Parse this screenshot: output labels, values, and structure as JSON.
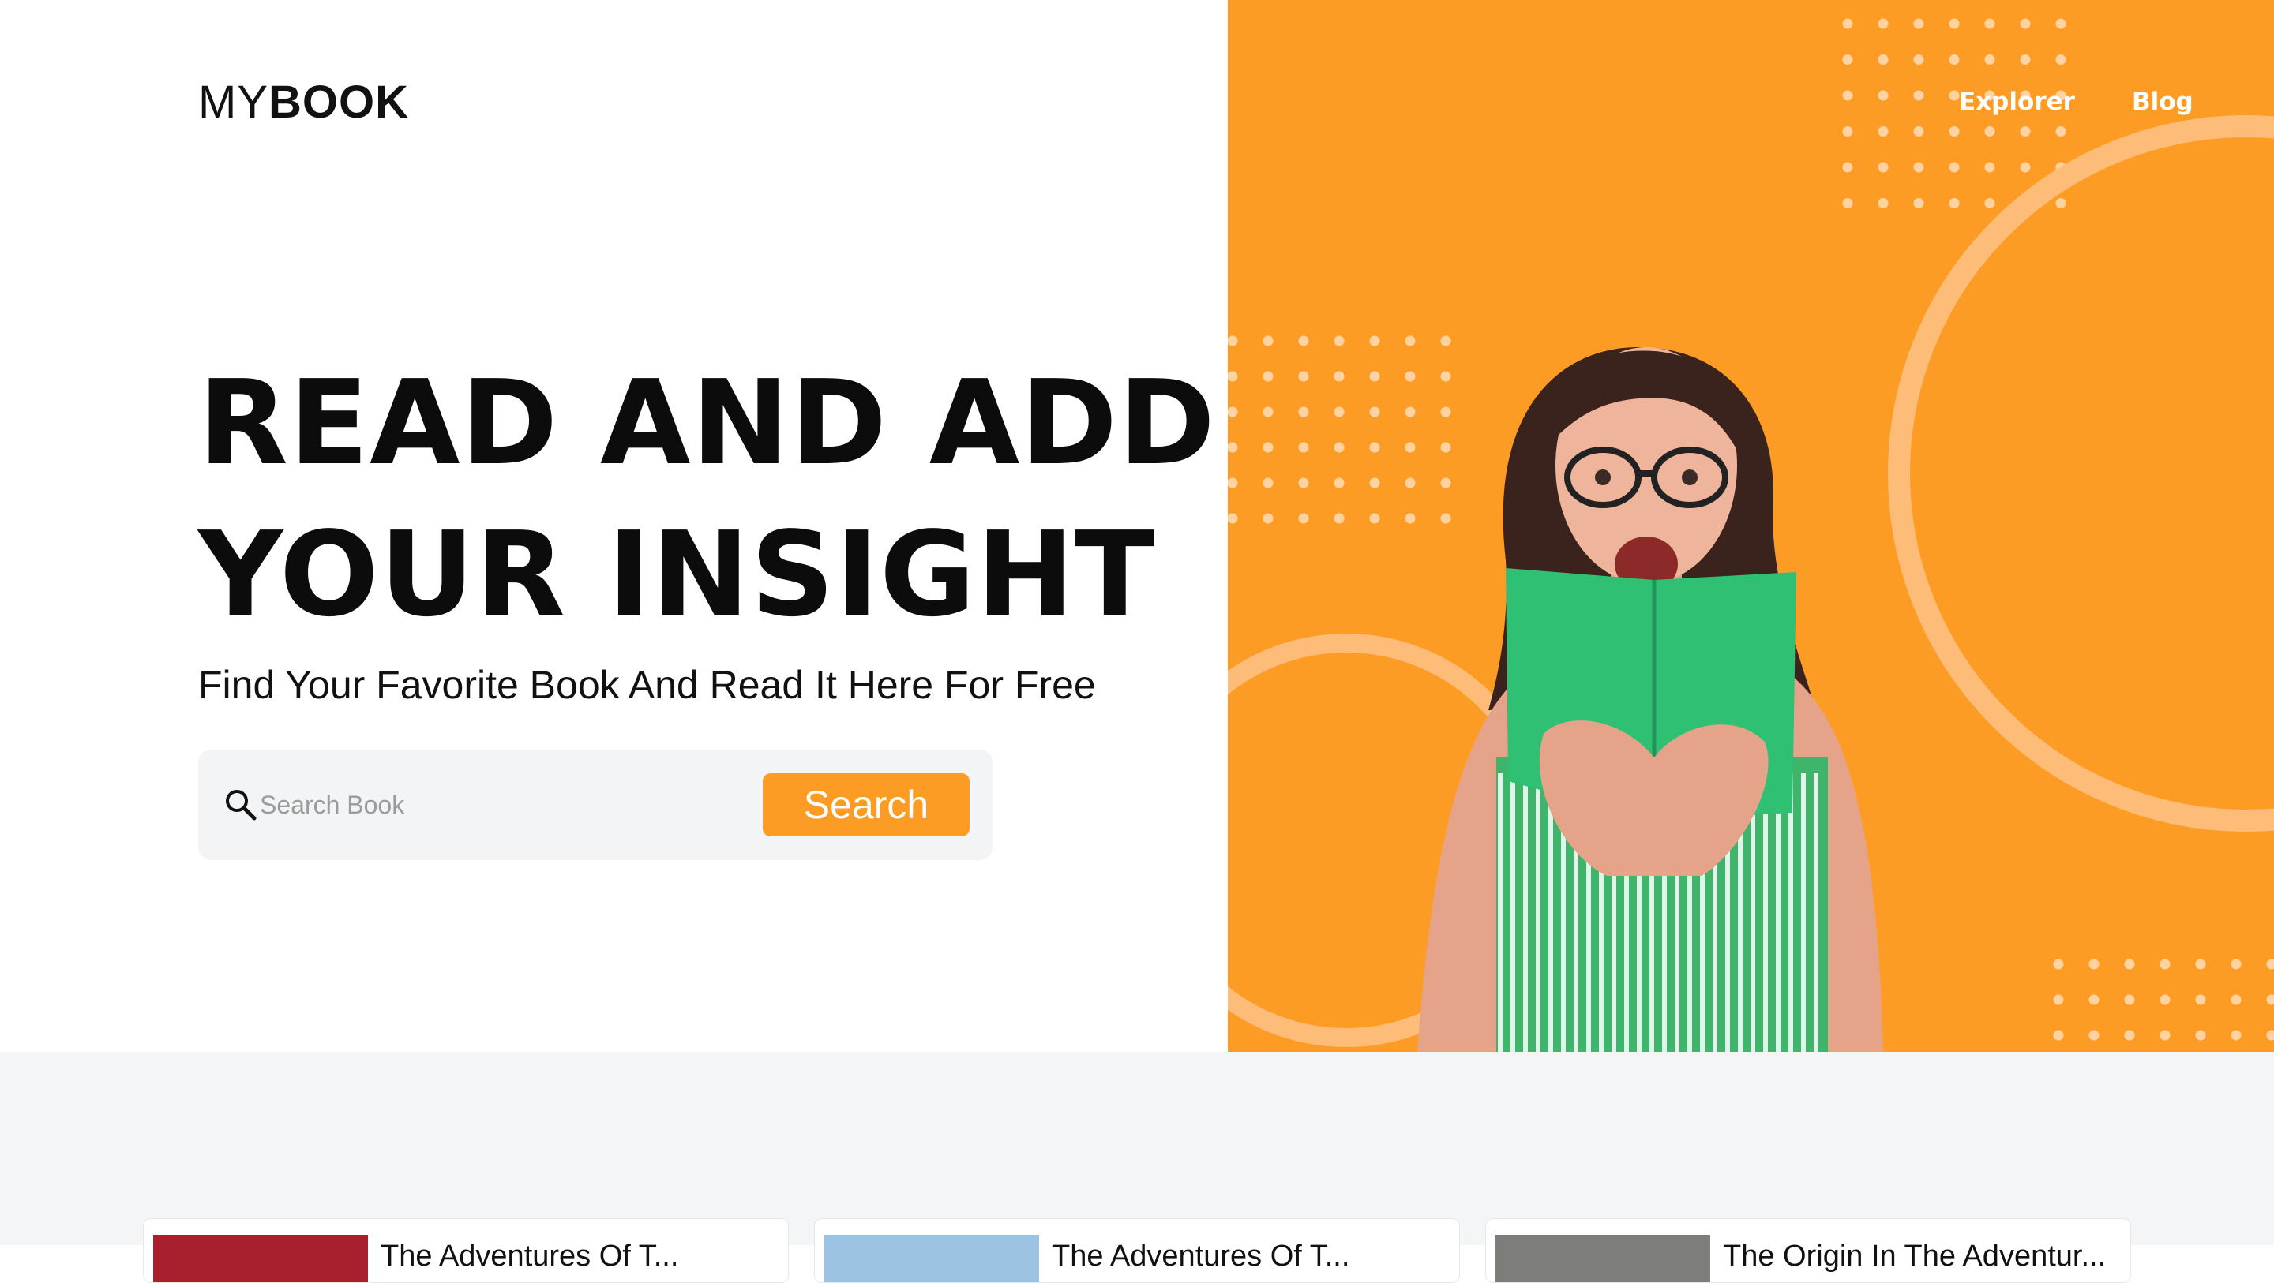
{
  "logo": {
    "light": "MY",
    "bold": "BOOK"
  },
  "nav": {
    "items": [
      {
        "label": "Explorer"
      },
      {
        "label": "Blog"
      }
    ]
  },
  "hero": {
    "headline_line1": "READ AND ADD",
    "headline_line2": "YOUR INSIGHT",
    "subtitle": "Find Your Favorite Book And Read It Here For Free"
  },
  "search": {
    "placeholder": "Search Book",
    "value": "",
    "button_label": "Search"
  },
  "cards": [
    {
      "title": "The Adventures Of T...",
      "cover_color": "#a8202d"
    },
    {
      "title": "The Adventures Of T...",
      "cover_color": "#9dc3e2"
    },
    {
      "title": "The Origin In The Adventur...",
      "cover_color": "#7d7d79"
    }
  ],
  "colors": {
    "accent": "#fd9c25",
    "text": "#0c0c0c",
    "search_bg": "#f3f4f5",
    "section_bg": "#f4f5f6",
    "book_green": "#2fc074"
  },
  "icons": {
    "search": "magnifier-icon"
  }
}
